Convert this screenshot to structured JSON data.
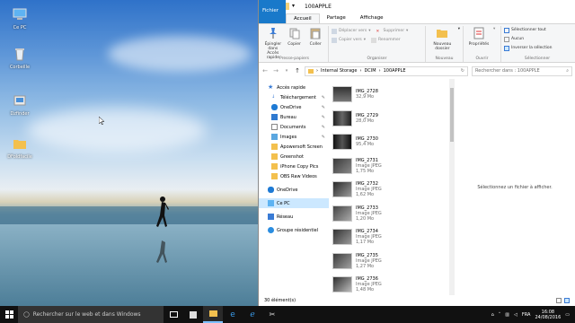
{
  "desktop": {
    "icons": [
      {
        "label": "Ce PC"
      },
      {
        "label": "Corbeille"
      },
      {
        "label": "Dzfinder"
      },
      {
        "label": "DFoldfacile"
      }
    ]
  },
  "explorer": {
    "title": "100APPLE",
    "tabs": {
      "file": "Fichier",
      "home": "Accueil",
      "share": "Partage",
      "view": "Affichage"
    },
    "ribbon": {
      "clipboard": {
        "pin": "Épingler dans Accès rapide",
        "copy": "Copier",
        "paste": "Coller",
        "name": "Presse-papiers"
      },
      "organize": {
        "move": "Déplacer vers",
        "copyto": "Copier vers",
        "delete": "Supprimer",
        "rename": "Renommer",
        "name": "Organiser"
      },
      "new": {
        "newfolder": "Nouveau dossier",
        "name": "Nouveau"
      },
      "open": {
        "properties": "Propriétés",
        "name": "Ouvrir"
      },
      "select": {
        "all": "Sélectionner tout",
        "none": "Aucun",
        "invert": "Inverser la sélection",
        "name": "Sélectionner"
      }
    },
    "address": {
      "crumbs": [
        "Internal Storage",
        "DCIM",
        "100APPLE"
      ],
      "search_placeholder": "Rechercher dans : 100APPLE"
    },
    "nav": {
      "quick_access": "Accès rapide",
      "items": [
        {
          "label": "Téléchargement",
          "pinned": true,
          "sub": true
        },
        {
          "label": "OneDrive",
          "pinned": true,
          "sub": true
        },
        {
          "label": "Bureau",
          "pinned": true,
          "sub": true
        },
        {
          "label": "Documents",
          "pinned": true,
          "sub": true
        },
        {
          "label": "Images",
          "pinned": true,
          "sub": true
        },
        {
          "label": "Apowersoft Screen",
          "pinned": false,
          "sub": true
        },
        {
          "label": "Greenshot",
          "pinned": false,
          "sub": true
        },
        {
          "label": "iPhone Copy Pics",
          "pinned": false,
          "sub": true
        },
        {
          "label": "OBS Raw Videos",
          "pinned": false,
          "sub": true
        }
      ],
      "onedrive": "OneDrive",
      "thispc": "Ce PC",
      "network": "Réseau",
      "homegroup": "Groupe résidentiel"
    },
    "files": [
      {
        "name": "IMG_2728",
        "type": "",
        "size": "32,9 Mo"
      },
      {
        "name": "IMG_2729",
        "type": "",
        "size": "28,0 Mo"
      },
      {
        "name": "IMG_2730",
        "type": "",
        "size": "95,4 Mo"
      },
      {
        "name": "IMG_2731",
        "type": "Image JPEG",
        "size": "1,75 Mo"
      },
      {
        "name": "IMG_2732",
        "type": "Image JPEG",
        "size": "1,62 Mo"
      },
      {
        "name": "IMG_2733",
        "type": "Image JPEG",
        "size": "1,20 Mo"
      },
      {
        "name": "IMG_2734",
        "type": "Image JPEG",
        "size": "1,17 Mo"
      },
      {
        "name": "IMG_2735",
        "type": "Image JPEG",
        "size": "1,27 Mo"
      },
      {
        "name": "IMG_2736",
        "type": "Image JPEG",
        "size": "1,48 Mo"
      }
    ],
    "preview_text": "Sélectionnez un fichier à afficher.",
    "status": "30 élément(s)"
  },
  "taskbar": {
    "search_placeholder": "Rechercher sur le web et dans Windows",
    "lang": "FRA",
    "time": "16:08",
    "date": "24/08/2016"
  },
  "colors": {
    "accent": "#1979ca",
    "selection": "#cce8ff",
    "taskbar": "#111111"
  }
}
